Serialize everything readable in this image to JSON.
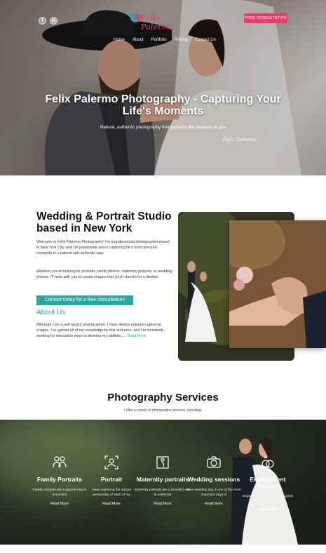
{
  "header": {
    "social": [
      {
        "icon": "facebook-icon",
        "glyph": "f"
      },
      {
        "icon": "instagram-icon",
        "glyph": "◎"
      }
    ],
    "logo_text": "Felix Palermo",
    "cta_label": "FREE CONSULTATION",
    "nav": [
      {
        "label": "Home",
        "active": true
      },
      {
        "label": "About"
      },
      {
        "label": "Portfolio"
      },
      {
        "label": "Pricing"
      },
      {
        "label": "Contact Us"
      }
    ]
  },
  "hero": {
    "title": "Felix Palermo Photography - Capturing Your Life's Moments",
    "subtitle": "Natural, authentic photography that captures the essence of you",
    "watermark": "Felix Palermo"
  },
  "about": {
    "heading": "Wedding & Portrait Studio based in New York",
    "paragraph1": "Welcome to Felix Palermo Photography! I'm a professional photographer based in New York City, and I'm passionate about capturing life's most precious moments in a natural and authentic way.",
    "paragraph2": "Whether you're looking for portraits, family photos, maternity pictures, or wedding photos, I'll work with you to create images that you'll cherish for a lifetime.",
    "contact_button": "Contact today for a free consultation!",
    "about_heading": "About Us",
    "paragraph3": "Although I am a self-taught photographer, I have always enjoyed capturing images. I've gained all of my knowledge by trial and error, and I'm constantly seeking for innovative ways to develop my abilities.....",
    "read_more": "Read More"
  },
  "services": {
    "heading": "Photography Services",
    "subheading": "I offer a variety of photography services, including:",
    "items": [
      {
        "name": "Family Portraits",
        "desc": "Family portraits are a special way to document",
        "more": "Read More",
        "icon": "family-icon"
      },
      {
        "name": "Portrait",
        "desc": "I love capturing the unique personality of each of my",
        "more": "Read More",
        "icon": "portrait-icon"
      },
      {
        "name": "Maternity portraits",
        "desc": "Maternity portraits are a beautiful way to celebrate",
        "more": "Read More",
        "icon": "maternity-icon"
      },
      {
        "name": "Wedding sessions",
        "desc": "Your wedding day is one of the most important days of",
        "more": "Read More",
        "icon": "wedding-camera-icon"
      },
      {
        "name": "Engagement Sessions",
        "desc": "Engagement sessions are a great way to get to",
        "more": "Read More",
        "icon": "rings-icon"
      }
    ]
  }
}
